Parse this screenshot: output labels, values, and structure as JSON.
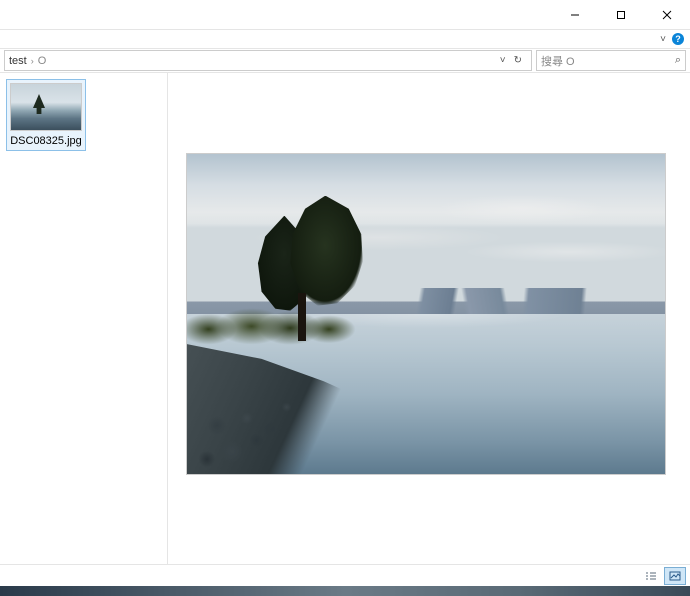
{
  "window": {
    "minimize_tip": "Minimize",
    "maximize_tip": "Maximize",
    "close_tip": "Close"
  },
  "ribbon": {
    "expand_glyph": "˅",
    "help_glyph": "?"
  },
  "breadcrumb": {
    "segment1": "test",
    "sep": "›",
    "segment2": "O",
    "history_glyph": "˅",
    "refresh_glyph": "↻"
  },
  "search": {
    "placeholder": "搜尋 O",
    "icon_glyph": "⌕"
  },
  "files": [
    {
      "name": "DSC08325.jpg"
    }
  ],
  "statusbar": {
    "view_details_tip": "Details",
    "view_thumbs_tip": "Large icons"
  }
}
